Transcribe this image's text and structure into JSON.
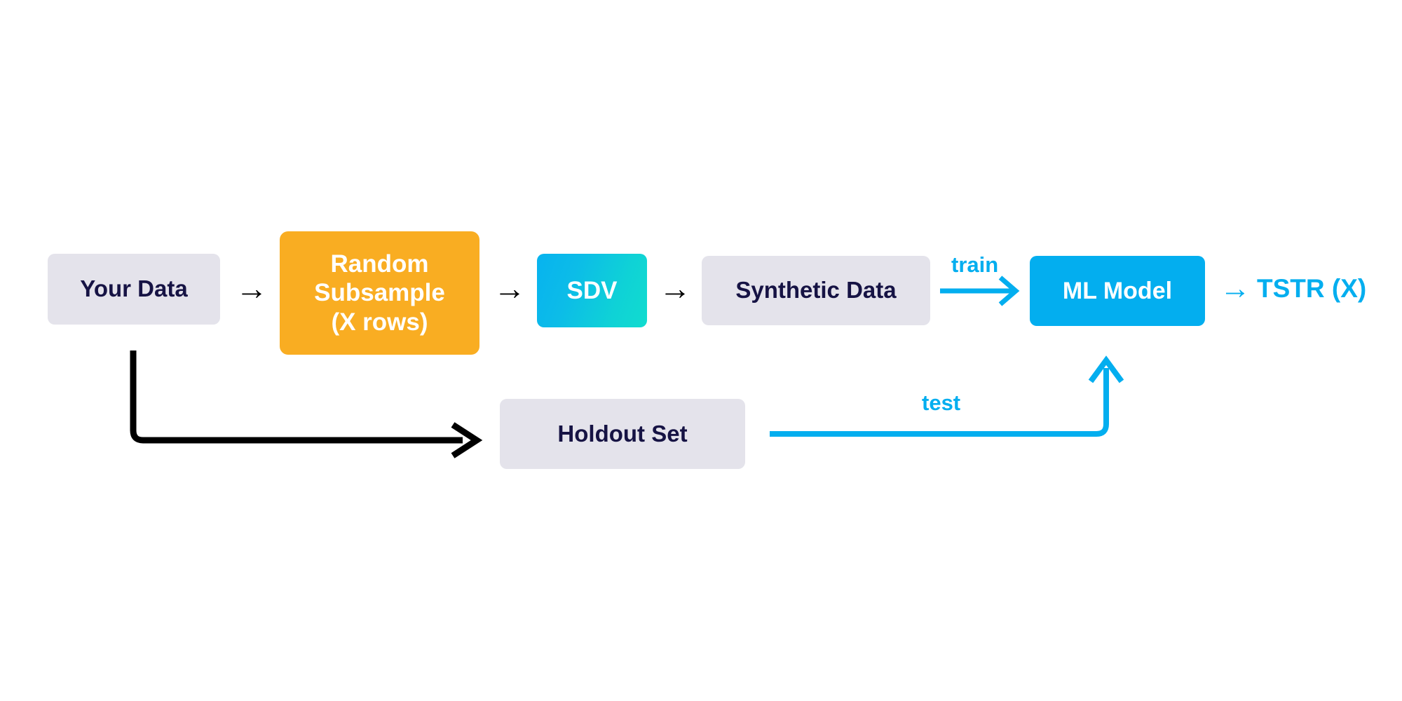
{
  "diagram": {
    "title_text": "",
    "background_color": "#ffffff",
    "colors": {
      "box_gray": "#e4e3eb",
      "text_navy": "#161344",
      "orange": "#f9ad22",
      "cyan": "#03aeef",
      "teal": "#11dccf",
      "black": "#000000",
      "white": "#ffffff"
    },
    "nodes": [
      {
        "id": "your-data",
        "label": "Your Data",
        "style": "gray"
      },
      {
        "id": "random-subsample",
        "label": "Random\nSubsample\n(X rows)",
        "style": "orange"
      },
      {
        "id": "sdv",
        "label": "SDV",
        "style": "sdv"
      },
      {
        "id": "synthetic-data",
        "label": "Synthetic Data",
        "style": "gray"
      },
      {
        "id": "ml-model",
        "label": "ML Model",
        "style": "cyan"
      },
      {
        "id": "holdout-set",
        "label": "Holdout Set",
        "style": "gray"
      }
    ],
    "edge_labels": {
      "train": "train",
      "test": "test"
    },
    "output_label": "TSTR (X)",
    "connector_glyphs": {
      "arrow_right": "→"
    }
  }
}
